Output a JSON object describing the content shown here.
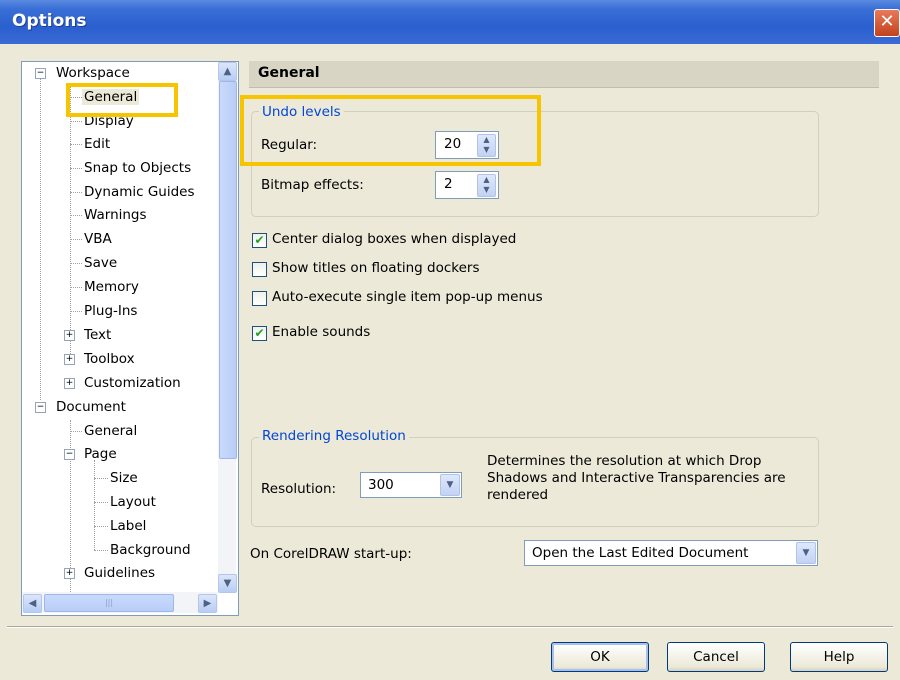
{
  "window": {
    "title": "Options",
    "close_symbol": "✕"
  },
  "tree": {
    "items": [
      {
        "label": "Workspace",
        "expander": "−"
      },
      {
        "label": "General"
      },
      {
        "label": "Display"
      },
      {
        "label": "Edit"
      },
      {
        "label": "Snap to Objects"
      },
      {
        "label": "Dynamic Guides"
      },
      {
        "label": "Warnings"
      },
      {
        "label": "VBA"
      },
      {
        "label": "Save"
      },
      {
        "label": "Memory"
      },
      {
        "label": "Plug-Ins"
      },
      {
        "label": "Text",
        "expander": "+"
      },
      {
        "label": "Toolbox",
        "expander": "+"
      },
      {
        "label": "Customization",
        "expander": "+"
      },
      {
        "label": "Document",
        "expander": "−"
      },
      {
        "label": "General"
      },
      {
        "label": "Page",
        "expander": "−"
      },
      {
        "label": "Size"
      },
      {
        "label": "Layout"
      },
      {
        "label": "Label"
      },
      {
        "label": "Background"
      },
      {
        "label": "Guidelines",
        "expander": "+"
      }
    ],
    "selected": "General"
  },
  "panel": {
    "header": "General",
    "undo": {
      "title": "Undo levels",
      "regular_label": "Regular:",
      "regular_value": "20",
      "bitmap_label": "Bitmap effects:",
      "bitmap_value": "2"
    },
    "options": [
      {
        "label": "Center dialog boxes when displayed",
        "checked": true
      },
      {
        "label": "Show titles on floating dockers",
        "checked": false
      },
      {
        "label": "Auto-execute single item pop-up menus",
        "checked": false
      },
      {
        "label": "Enable sounds",
        "checked": true
      }
    ],
    "rendering": {
      "title": "Rendering Resolution",
      "resolution_label": "Resolution:",
      "resolution_value": "300",
      "description": "Determines the resolution at which Drop Shadows and Interactive Transparencies are rendered"
    },
    "startup": {
      "label": "On CorelDRAW start-up:",
      "value": "Open the Last Edited Document"
    }
  },
  "buttons": {
    "ok": "OK",
    "cancel": "Cancel",
    "help": "Help"
  },
  "colors": {
    "highlight": "#f7c500",
    "titlebar": "#2a5fcf",
    "group_title": "#0046d5",
    "check": "#21a121"
  }
}
